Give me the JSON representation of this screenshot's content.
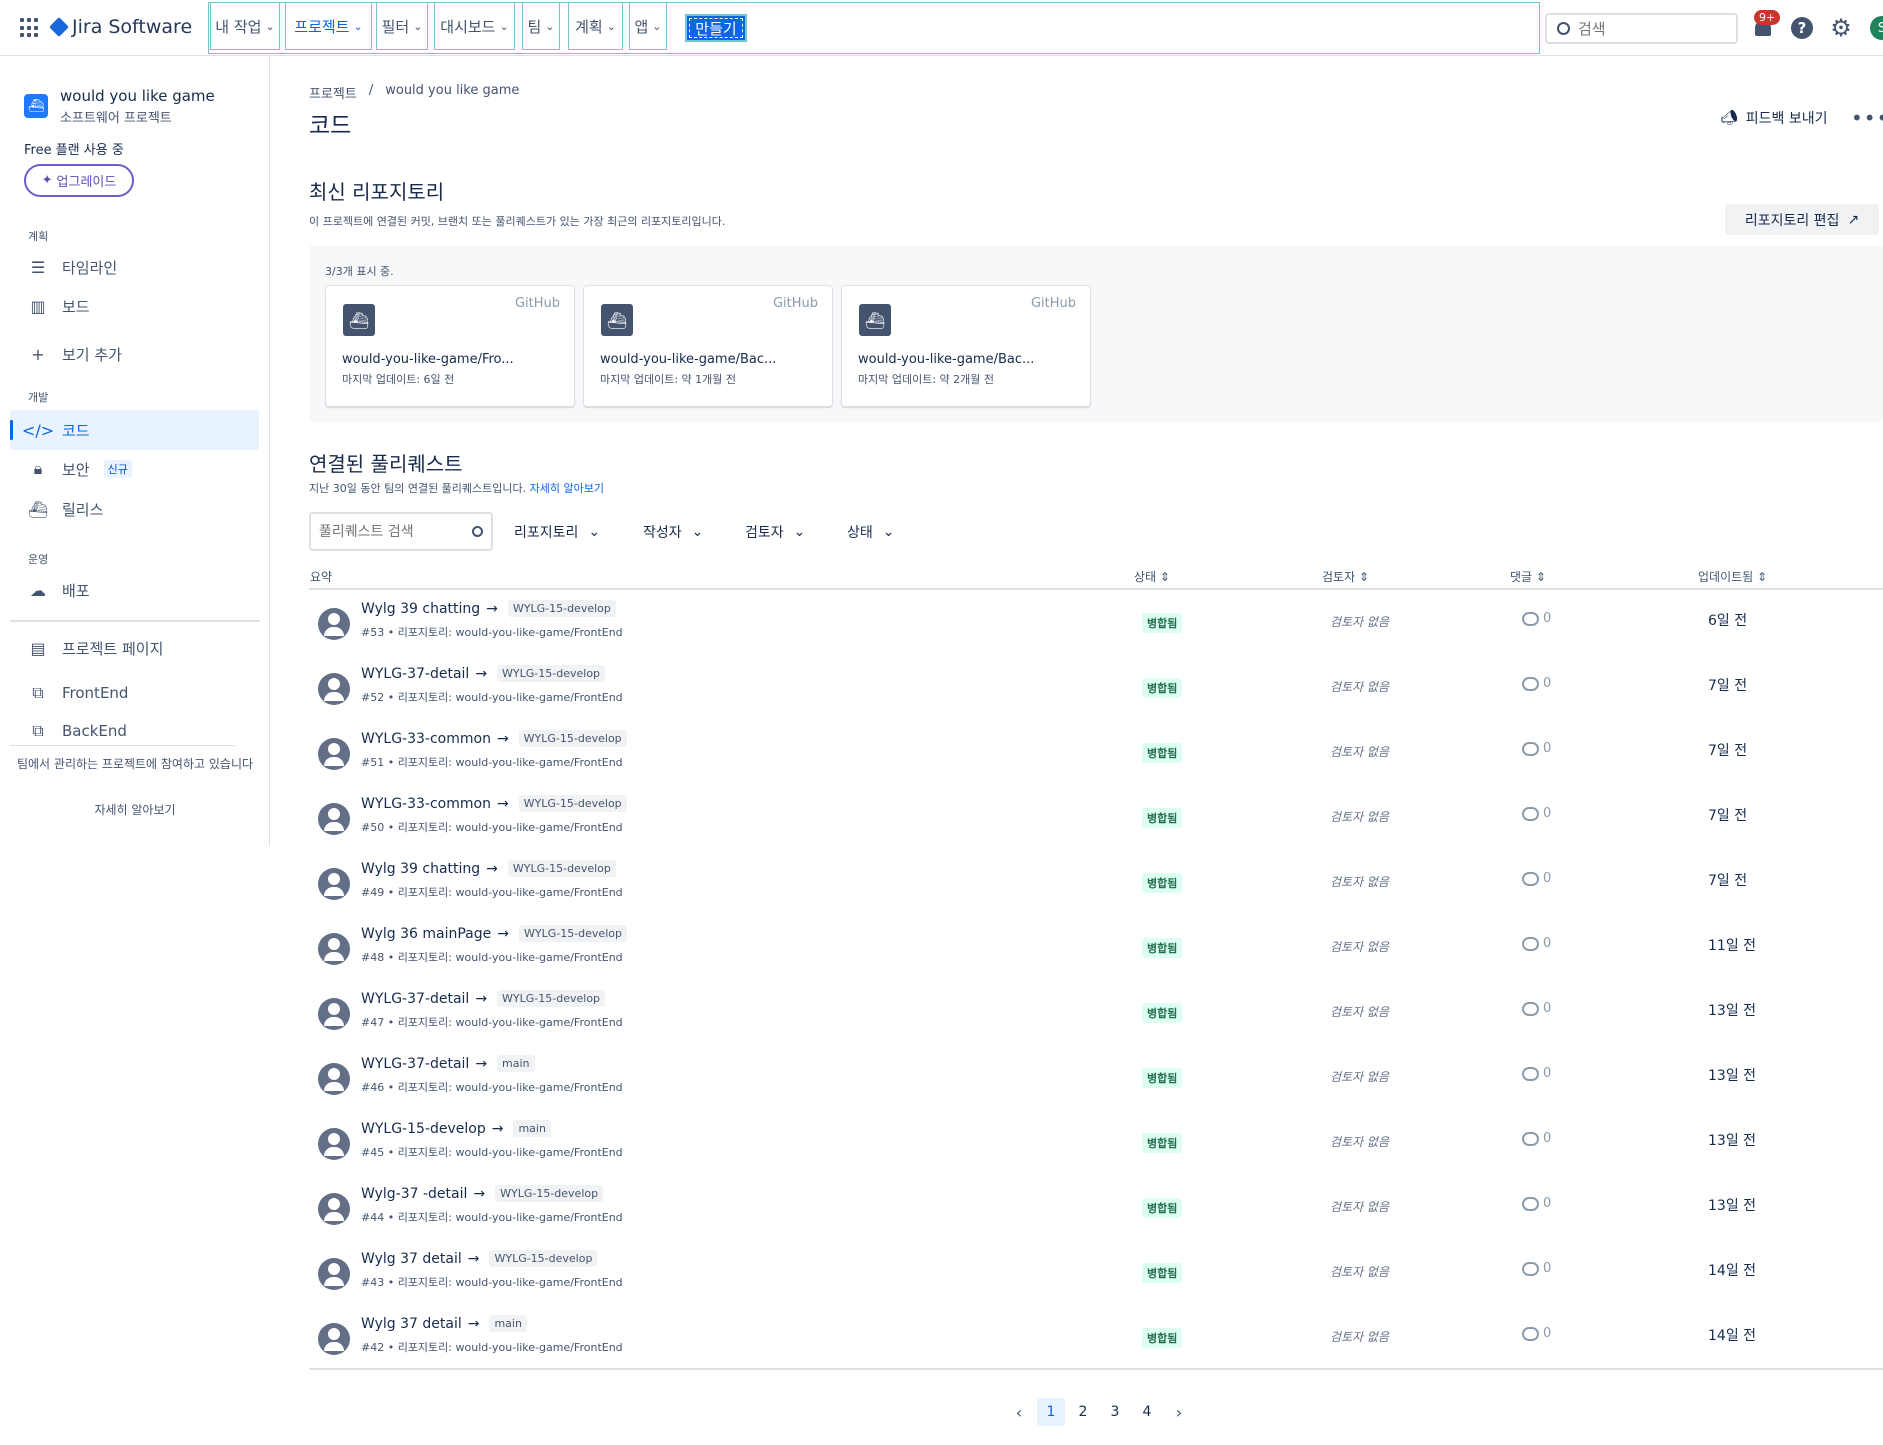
{
  "topbar": {
    "logo_text": "Jira Software",
    "nav": [
      {
        "label": "내 작업"
      },
      {
        "label": "프로젝트"
      },
      {
        "label": "필터"
      },
      {
        "label": "대시보드"
      },
      {
        "label": "팀"
      },
      {
        "label": "계획"
      },
      {
        "label": "앱"
      }
    ],
    "create_label": "만들기",
    "search_placeholder": "검색",
    "notification_badge": "9+",
    "avatar_initial": "S"
  },
  "sidebar": {
    "project_name": "would you like game",
    "project_type": "소프트웨어 프로젝트",
    "plan": "Free 플랜 사용 중",
    "upgrade": "업그레이드",
    "section_plan": "계획",
    "section_dev": "개발",
    "section_ops": "운영",
    "items": {
      "timeline": "타임라인",
      "board": "보드",
      "add_view": "보기 추가",
      "code": "코드",
      "security": "보안",
      "security_badge": "신규",
      "releases": "릴리스",
      "deploy": "배포",
      "project_pages": "프로젝트 페이지",
      "frontend": "FrontEnd",
      "backend": "BackEnd"
    },
    "footer_text": "팀에서 관리하는 프로젝트에 참여하고 있습니다",
    "footer_link": "자세히 알아보기"
  },
  "main": {
    "breadcrumb_root": "프로젝트",
    "breadcrumb_sep": "/",
    "breadcrumb_project": "would you like game",
    "title": "코드",
    "feedback": "피드백 보내기",
    "recent_repos_title": "최신 리포지토리",
    "recent_repos_desc": "이 프로젝트에 연결된 커밋, 브랜치 또는 풀리퀘스트가 있는 가장 최근의 리포지토리입니다.",
    "edit_repos": "리포지토리 편집",
    "repo_count": "3/3개 표시 중.",
    "repos": [
      {
        "source": "GitHub",
        "name": "would-you-like-game/Fro...",
        "updated": "마지막 업데이트: 6일 전"
      },
      {
        "source": "GitHub",
        "name": "would-you-like-game/Bac...",
        "updated": "마지막 업데이트: 약 1개월 전"
      },
      {
        "source": "GitHub",
        "name": "would-you-like-game/Bac...",
        "updated": "마지막 업데이트: 약 2개월 전"
      }
    ],
    "prs_title": "연결된 풀리퀘스트",
    "prs_desc": "지난 30일 동안 팀의 연결된 풀리퀘스트입니다.",
    "prs_link": "자세히 알아보기",
    "pr_search_placeholder": "풀리퀘스트 검색",
    "filters": {
      "repo": "리포지토리",
      "author": "작성자",
      "reviewer": "검토자",
      "status": "상태"
    },
    "columns": {
      "summary": "요약",
      "status": "상태",
      "reviewer": "검토자",
      "comments": "댓글",
      "updated": "업데이트됨"
    },
    "rows": [
      {
        "title": "Wylg 39 chatting",
        "branch": "WYLG-15-develop",
        "sub": "#53 • 리포지토리: would-you-like-game/FrontEnd",
        "status": "병합됨",
        "reviewer": "검토자 없음",
        "comments": "0",
        "updated": "6일 전"
      },
      {
        "title": "WYLG-37-detail",
        "branch": "WYLG-15-develop",
        "sub": "#52 • 리포지토리: would-you-like-game/FrontEnd",
        "status": "병합됨",
        "reviewer": "검토자 없음",
        "comments": "0",
        "updated": "7일 전"
      },
      {
        "title": "WYLG-33-common",
        "branch": "WYLG-15-develop",
        "sub": "#51 • 리포지토리: would-you-like-game/FrontEnd",
        "status": "병합됨",
        "reviewer": "검토자 없음",
        "comments": "0",
        "updated": "7일 전"
      },
      {
        "title": "WYLG-33-common",
        "branch": "WYLG-15-develop",
        "sub": "#50 • 리포지토리: would-you-like-game/FrontEnd",
        "status": "병합됨",
        "reviewer": "검토자 없음",
        "comments": "0",
        "updated": "7일 전"
      },
      {
        "title": "Wylg 39 chatting",
        "branch": "WYLG-15-develop",
        "sub": "#49 • 리포지토리: would-you-like-game/FrontEnd",
        "status": "병합됨",
        "reviewer": "검토자 없음",
        "comments": "0",
        "updated": "7일 전"
      },
      {
        "title": "Wylg 36 mainPage",
        "branch": "WYLG-15-develop",
        "sub": "#48 • 리포지토리: would-you-like-game/FrontEnd",
        "status": "병합됨",
        "reviewer": "검토자 없음",
        "comments": "0",
        "updated": "11일 전"
      },
      {
        "title": "WYLG-37-detail",
        "branch": "WYLG-15-develop",
        "sub": "#47 • 리포지토리: would-you-like-game/FrontEnd",
        "status": "병합됨",
        "reviewer": "검토자 없음",
        "comments": "0",
        "updated": "13일 전"
      },
      {
        "title": "WYLG-37-detail",
        "branch": "main",
        "sub": "#46 • 리포지토리: would-you-like-game/FrontEnd",
        "status": "병합됨",
        "reviewer": "검토자 없음",
        "comments": "0",
        "updated": "13일 전"
      },
      {
        "title": "WYLG-15-develop",
        "branch": "main",
        "sub": "#45 • 리포지토리: would-you-like-game/FrontEnd",
        "status": "병합됨",
        "reviewer": "검토자 없음",
        "comments": "0",
        "updated": "13일 전"
      },
      {
        "title": "Wylg-37 -detail",
        "branch": "WYLG-15-develop",
        "sub": "#44 • 리포지토리: would-you-like-game/FrontEnd",
        "status": "병합됨",
        "reviewer": "검토자 없음",
        "comments": "0",
        "updated": "13일 전"
      },
      {
        "title": "Wylg 37 detail",
        "branch": "WYLG-15-develop",
        "sub": "#43 • 리포지토리: would-you-like-game/FrontEnd",
        "status": "병합됨",
        "reviewer": "검토자 없음",
        "comments": "0",
        "updated": "14일 전"
      },
      {
        "title": "Wylg 37 detail",
        "branch": "main",
        "sub": "#42 • 리포지토리: would-you-like-game/FrontEnd",
        "status": "병합됨",
        "reviewer": "검토자 없음",
        "comments": "0",
        "updated": "14일 전"
      }
    ],
    "pagination": {
      "pages": [
        "1",
        "2",
        "3",
        "4"
      ],
      "current": "1"
    }
  }
}
